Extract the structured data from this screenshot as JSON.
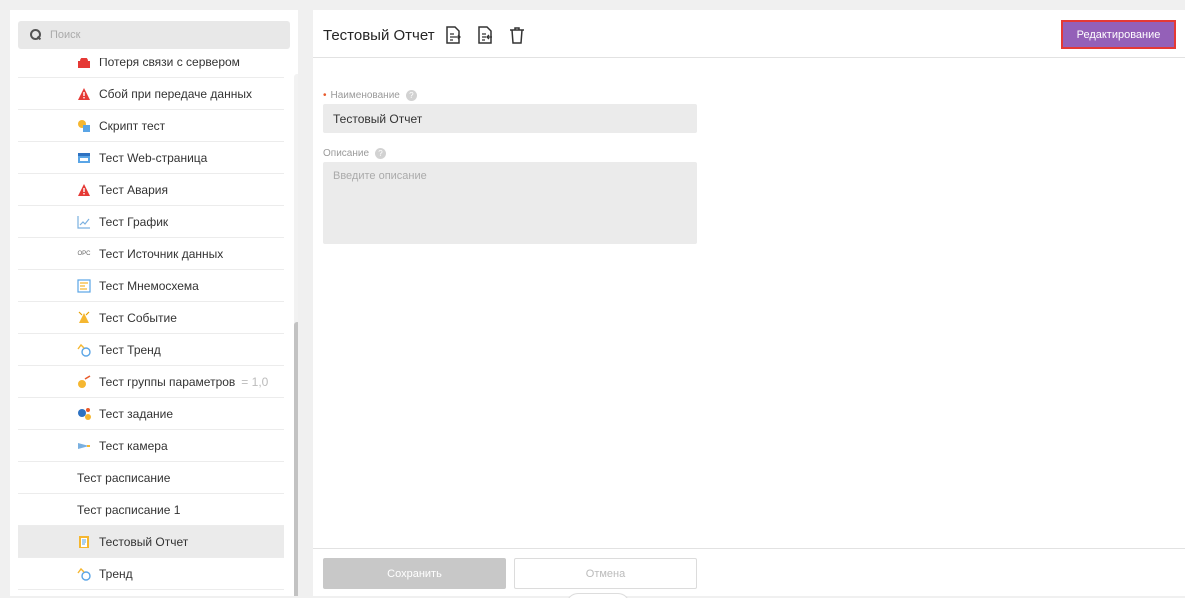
{
  "search": {
    "placeholder": "Поиск"
  },
  "tree": {
    "items": [
      {
        "label": "Потеря связи с сервером",
        "icon": "alarm-red-icon",
        "suffix": ""
      },
      {
        "label": "Сбой при передаче данных",
        "icon": "warning-icon",
        "suffix": ""
      },
      {
        "label": "Скрипт тест",
        "icon": "script-icon",
        "suffix": ""
      },
      {
        "label": "Тест Web-страница",
        "icon": "webpage-icon",
        "suffix": ""
      },
      {
        "label": "Тест Авария",
        "icon": "warning-icon",
        "suffix": ""
      },
      {
        "label": "Тест График",
        "icon": "chart-icon",
        "suffix": ""
      },
      {
        "label": "Тест Источник данных",
        "icon": "opc-icon",
        "icon_text": "OPC",
        "suffix": ""
      },
      {
        "label": "Тест Мнемосхема",
        "icon": "mnemo-icon",
        "suffix": ""
      },
      {
        "label": "Тест Событие",
        "icon": "event-icon",
        "suffix": ""
      },
      {
        "label": "Тест Тренд",
        "icon": "trend-icon",
        "suffix": ""
      },
      {
        "label": "Тест группы параметров",
        "icon": "param-group-icon",
        "suffix": "= 1,0"
      },
      {
        "label": "Тест задание",
        "icon": "task-icon",
        "suffix": ""
      },
      {
        "label": "Тест камера",
        "icon": "camera-icon",
        "suffix": ""
      },
      {
        "label": "Тест расписание",
        "icon": "",
        "suffix": ""
      },
      {
        "label": "Тест расписание 1",
        "icon": "",
        "suffix": ""
      },
      {
        "label": "Тестовый Отчет",
        "icon": "report-icon",
        "suffix": "",
        "selected": true
      },
      {
        "label": "Тренд",
        "icon": "trend-icon",
        "suffix": ""
      }
    ]
  },
  "header": {
    "title": "Тестовый Отчет",
    "edit_label": "Редактирование"
  },
  "form": {
    "name_label": "Наименование",
    "name_value": "Тестовый Отчет",
    "description_label": "Описание",
    "description_placeholder": "Введите описание",
    "description_value": ""
  },
  "footer": {
    "save_label": "Сохранить",
    "cancel_label": "Отмена"
  },
  "colors": {
    "accent": "#9460b8",
    "highlight_border": "#e53935",
    "required": "#e85a2b"
  }
}
